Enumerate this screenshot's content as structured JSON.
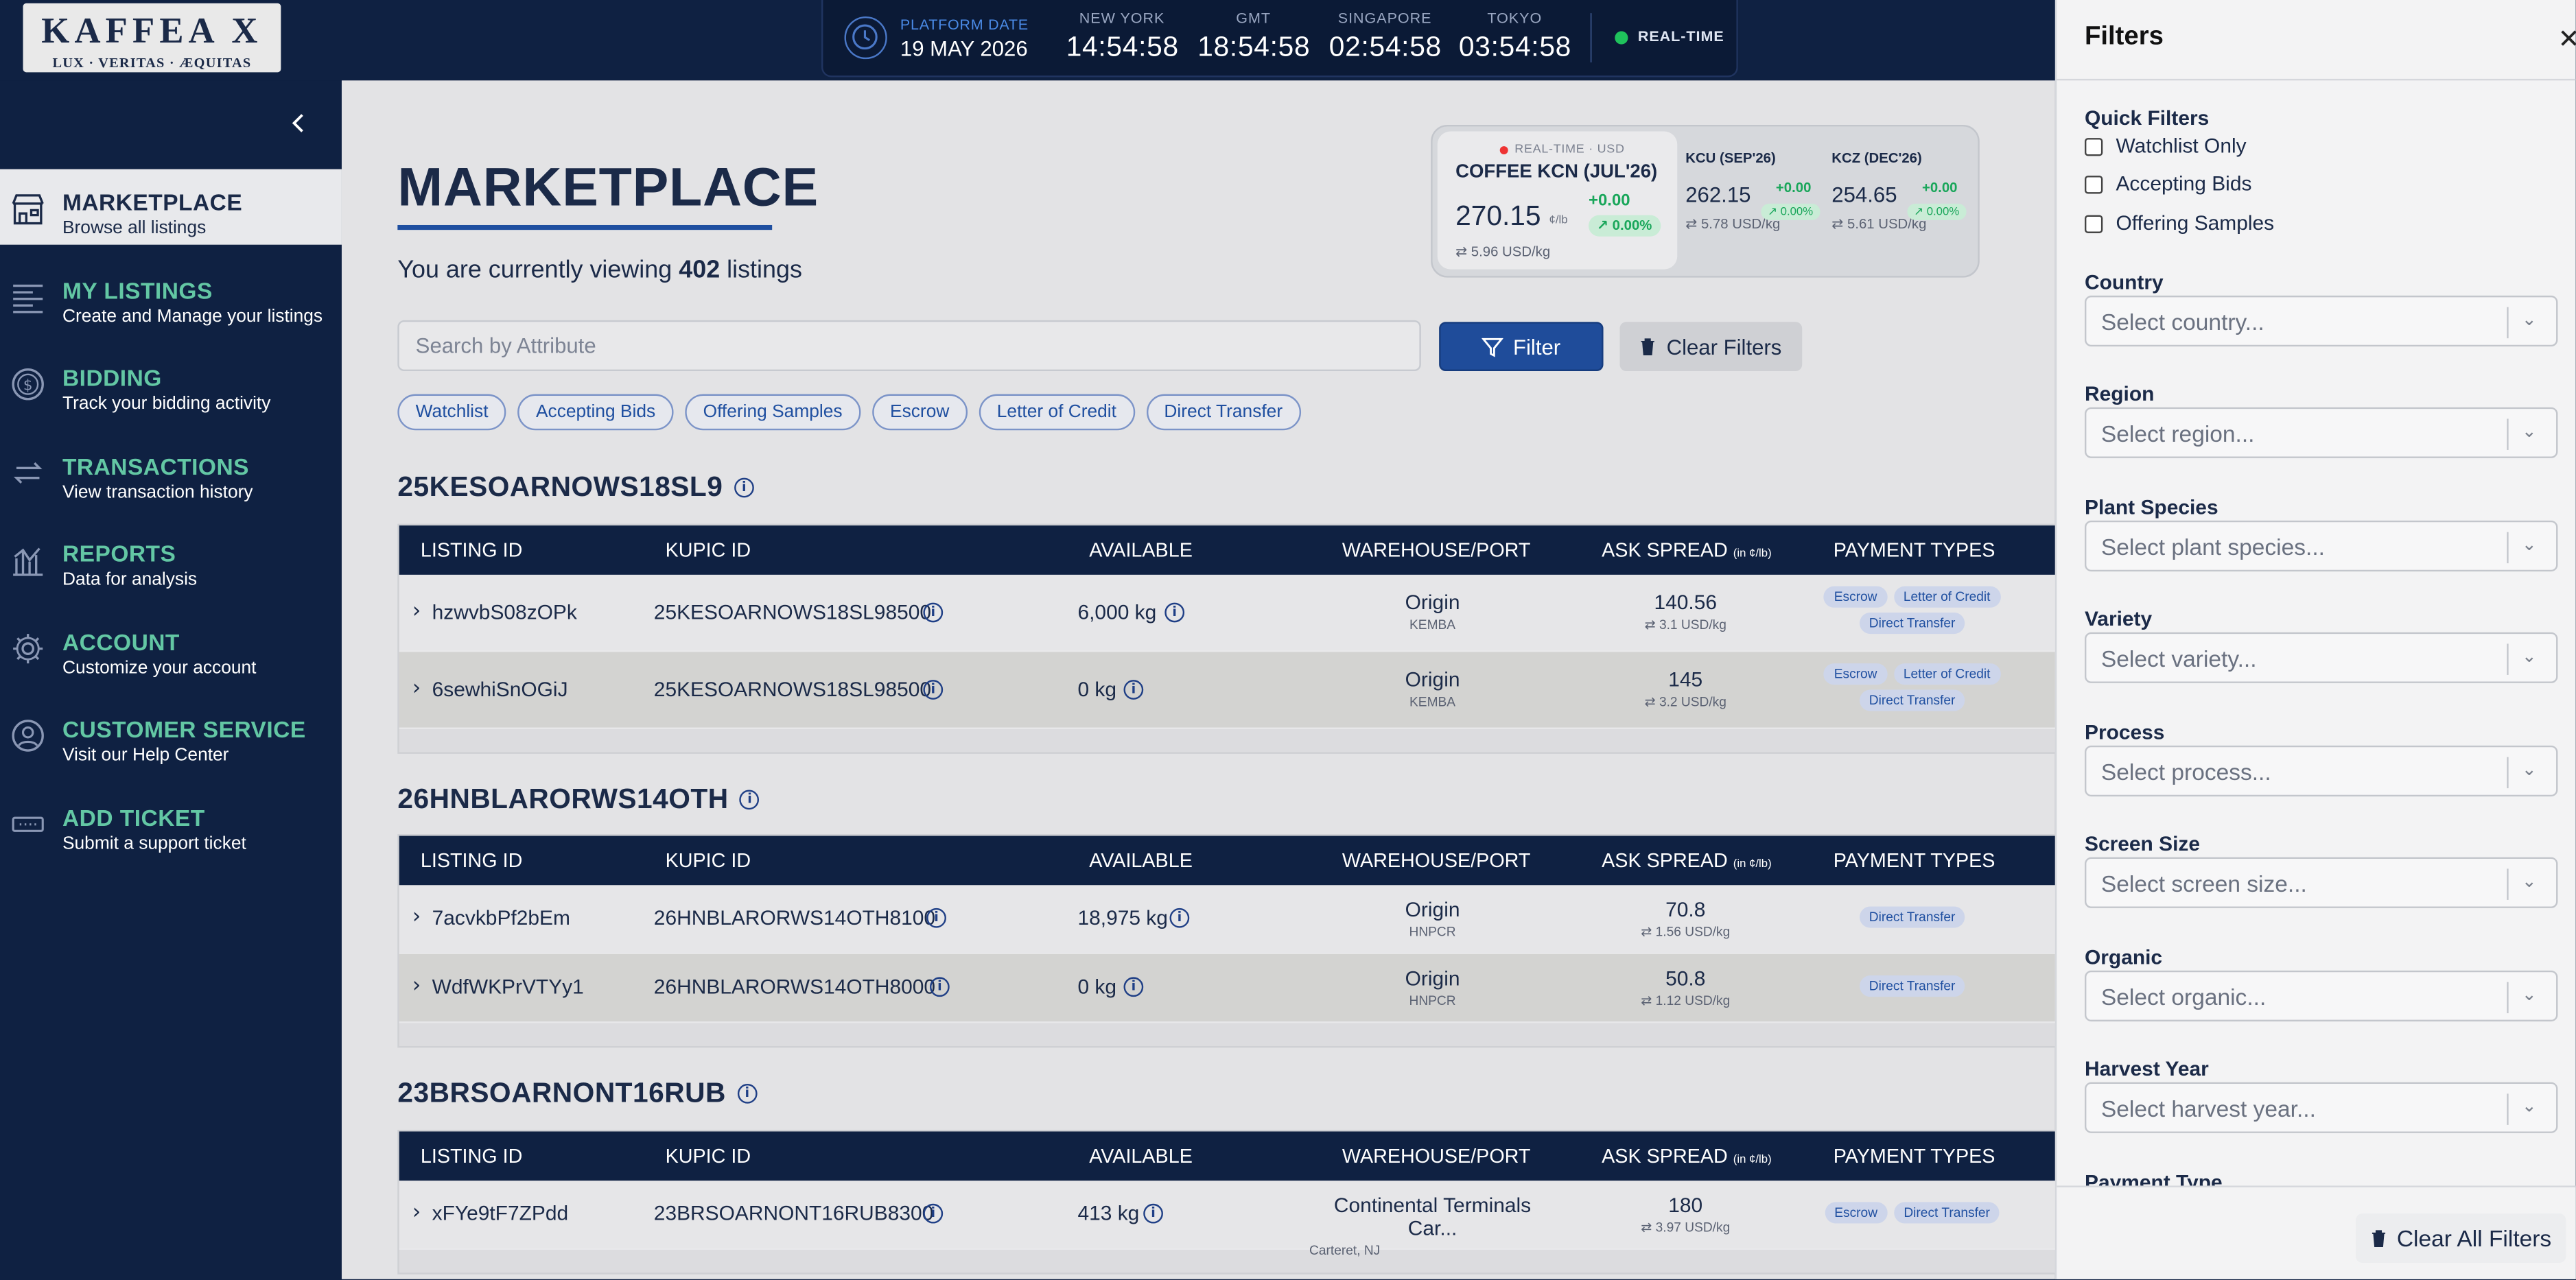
{
  "logo": {
    "main": "KAFFEA X",
    "sub": "LUX · VERITAS · ÆQUITAS"
  },
  "clockbar": {
    "platform_label": "PLATFORM DATE",
    "platform_date": "19 MAY 2026",
    "cities": [
      {
        "name": "NEW YORK",
        "time": "14:54:58"
      },
      {
        "name": "GMT",
        "time": "18:54:58"
      },
      {
        "name": "SINGAPORE",
        "time": "02:54:58"
      },
      {
        "name": "TOKYO",
        "time": "03:54:58"
      }
    ],
    "status": "REAL-TIME",
    "status_color": "#1fc25c"
  },
  "sidebar": {
    "items": [
      {
        "title": "MARKETPLACE",
        "sub": "Browse all listings",
        "icon": "store-icon"
      },
      {
        "title": "MY LISTINGS",
        "sub": "Create and Manage your listings",
        "icon": "list-icon"
      },
      {
        "title": "BIDDING",
        "sub": "Track your bidding activity",
        "icon": "dollar-icon"
      },
      {
        "title": "TRANSACTIONS",
        "sub": "View transaction history",
        "icon": "transfer-icon"
      },
      {
        "title": "REPORTS",
        "sub": "Data for analysis",
        "icon": "chart-icon"
      },
      {
        "title": "ACCOUNT",
        "sub": "Customize your account",
        "icon": "gear-icon"
      },
      {
        "title": "CUSTOMER SERVICE",
        "sub": "Visit our Help Center",
        "icon": "user-icon"
      },
      {
        "title": "ADD TICKET",
        "sub": "Submit a support ticket",
        "icon": "ticket-icon"
      }
    ]
  },
  "main": {
    "title": "MARKETPLACE",
    "viewing_prefix": "You are currently viewing ",
    "viewing_count": "402",
    "viewing_suffix": " listings",
    "search_placeholder": "Search by Attribute",
    "filter_label": "Filter",
    "clear_label": "Clear Filters",
    "chips": [
      "Watchlist",
      "Accepting Bids",
      "Offering Samples",
      "Escrow",
      "Letter of Credit",
      "Direct Transfer"
    ]
  },
  "ticker": {
    "rt": "REAL-TIME · USD",
    "main": {
      "name": "COFFEE KCN (JUL'26)",
      "price": "270.15",
      "unit": "¢/lb",
      "chg": "+0.00",
      "pct": "↗ 0.00%",
      "usd": "⇄ 5.96 USD/kg"
    },
    "others": [
      {
        "name": "KCU (SEP'26)",
        "price": "262.15",
        "chg": "+0.00",
        "pct": "↗ 0.00%",
        "usd": "⇄ 5.78 USD/kg"
      },
      {
        "name": "KCZ (DEC'26)",
        "price": "254.65",
        "chg": "+0.00",
        "pct": "↗ 0.00%",
        "usd": "⇄ 5.61 USD/kg"
      }
    ]
  },
  "table_headers": {
    "listing": "LISTING ID",
    "kupic": "KUPIC ID",
    "available": "AVAILABLE",
    "warehouse": "WAREHOUSE/PORT",
    "ask": "ASK SPREAD",
    "ask_unit": "(in ¢/lb)",
    "payment": "PAYMENT TYPES"
  },
  "groups": [
    {
      "name": "25KESOARNOWS18SL9",
      "rows": [
        {
          "listing": "hzwvbS08zOPk",
          "kupic": "25KESOARNOWS18SL98500",
          "available": "6,000 kg",
          "wh": "Origin",
          "wh_sub": "KEMBA",
          "ask": "140.56",
          "ask_usd": "⇄ 3.1 USD/kg",
          "pay": [
            "Escrow",
            "Letter of Credit",
            "Direct Transfer"
          ]
        },
        {
          "listing": "6sewhiSnOGiJ",
          "kupic": "25KESOARNOWS18SL98500",
          "available": "0 kg",
          "wh": "Origin",
          "wh_sub": "KEMBA",
          "ask": "145",
          "ask_usd": "⇄ 3.2 USD/kg",
          "pay": [
            "Escrow",
            "Letter of Credit",
            "Direct Transfer"
          ]
        }
      ]
    },
    {
      "name": "26HNBLARORWS14OTH",
      "rows": [
        {
          "listing": "7acvkbPf2bEm",
          "kupic": "26HNBLARORWS14OTH8100",
          "available": "18,975 kg",
          "wh": "Origin",
          "wh_sub": "HNPCR",
          "ask": "70.8",
          "ask_usd": "⇄ 1.56 USD/kg",
          "pay": [
            "Direct Transfer"
          ]
        },
        {
          "listing": "WdfWKPrVTYy1",
          "kupic": "26HNBLARORWS14OTH8000",
          "available": "0 kg",
          "wh": "Origin",
          "wh_sub": "HNPCR",
          "ask": "50.8",
          "ask_usd": "⇄ 1.12 USD/kg",
          "pay": [
            "Direct Transfer"
          ]
        }
      ]
    },
    {
      "name": "23BRSOARNONT16RUB",
      "rows": [
        {
          "listing": "xFYe9tF7ZPdd",
          "kupic": "23BRSOARNONT16RUB8300",
          "available": "413 kg",
          "wh": "Continental Terminals Car...",
          "wh_sub": "Carteret, NJ",
          "ask": "180",
          "ask_usd": "⇄ 3.97 USD/kg",
          "pay": [
            "Escrow",
            "Direct Transfer"
          ]
        }
      ]
    }
  ],
  "filters": {
    "title": "Filters",
    "close": "✕",
    "quick_label": "Quick Filters",
    "quick": [
      "Watchlist Only",
      "Accepting Bids",
      "Offering Samples"
    ],
    "fields": [
      {
        "label": "Country",
        "placeholder": "Select country..."
      },
      {
        "label": "Region",
        "placeholder": "Select region..."
      },
      {
        "label": "Plant Species",
        "placeholder": "Select plant species..."
      },
      {
        "label": "Variety",
        "placeholder": "Select variety..."
      },
      {
        "label": "Process",
        "placeholder": "Select process..."
      },
      {
        "label": "Screen Size",
        "placeholder": "Select screen size..."
      },
      {
        "label": "Organic",
        "placeholder": "Select organic..."
      },
      {
        "label": "Harvest Year",
        "placeholder": "Select harvest year..."
      },
      {
        "label": "Payment Type",
        "placeholder": ""
      }
    ],
    "clear_all": "Clear All Filters"
  }
}
